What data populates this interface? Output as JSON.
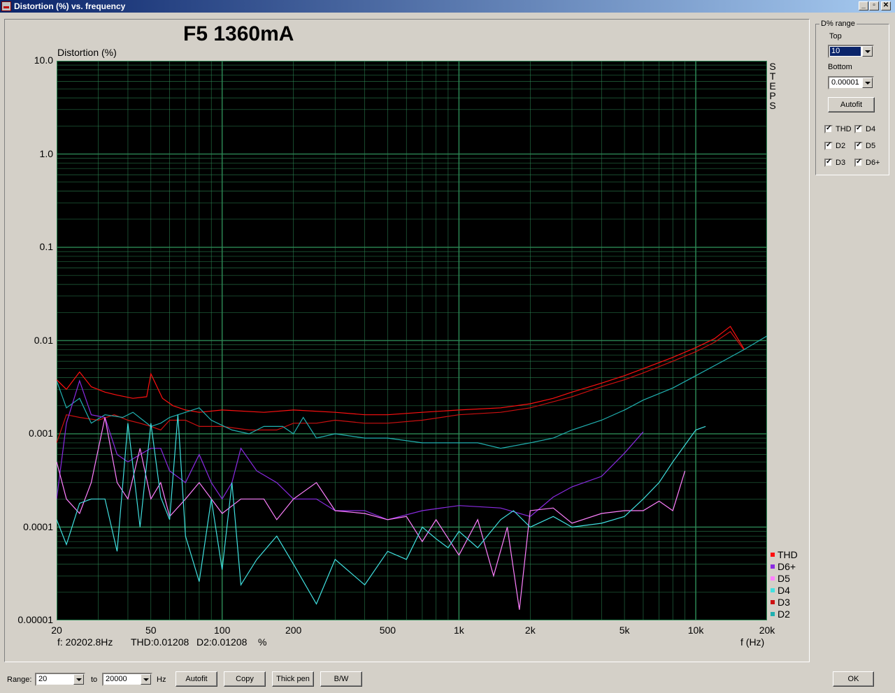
{
  "window": {
    "title": "Distortion (%) vs. frequency",
    "buttons": [
      "_",
      "▫",
      "✕"
    ]
  },
  "graph": {
    "title": "F5 1360mA",
    "readout": {
      "freq": "f: 20202.8Hz",
      "thd": "THD:0.01208",
      "d2": "D2:0.01208",
      "unit": "%"
    },
    "side_label": [
      "S",
      "T",
      "E",
      "P",
      "S"
    ],
    "legend": [
      {
        "name": "THD",
        "color": "#ff1010"
      },
      {
        "name": "D6+",
        "color": "#8a2be2"
      },
      {
        "name": "D5",
        "color": "#ff80ff"
      },
      {
        "name": "D4",
        "color": "#40e0e0"
      },
      {
        "name": "D3",
        "color": "#cc1010"
      },
      {
        "name": "D2",
        "color": "#20b0b0"
      }
    ]
  },
  "chart_data": {
    "type": "line",
    "ylabel": "Distortion (%)",
    "xlabel": "f (Hz)",
    "xscale": "log",
    "yscale": "log",
    "xlim": [
      20,
      20000
    ],
    "ylim": [
      1e-05,
      10
    ],
    "grid": true,
    "background": "#000000",
    "grid_color": "#2e8b57",
    "legend_position": "bottom-right",
    "x_ticks": [
      {
        "label": "20",
        "value": 20
      },
      {
        "label": "50",
        "value": 50
      },
      {
        "label": "100",
        "value": 100
      },
      {
        "label": "200",
        "value": 200
      },
      {
        "label": "500",
        "value": 500
      },
      {
        "label": "1k",
        "value": 1000
      },
      {
        "label": "2k",
        "value": 2000
      },
      {
        "label": "5k",
        "value": 5000
      },
      {
        "label": "10k",
        "value": 10000
      },
      {
        "label": "20k",
        "value": 20000
      }
    ],
    "y_ticks": [
      {
        "label": "10.0",
        "value": 10
      },
      {
        "label": "1.0",
        "value": 1
      },
      {
        "label": "0.1",
        "value": 0.1
      },
      {
        "label": "0.01",
        "value": 0.01
      },
      {
        "label": "0.001",
        "value": 0.001
      },
      {
        "label": "0.0001",
        "value": 0.0001
      },
      {
        "label": "0.00001",
        "value": 1e-05
      }
    ],
    "series": [
      {
        "name": "THD",
        "color": "#ff1010",
        "points": [
          [
            20,
            0.0038
          ],
          [
            22,
            0.003
          ],
          [
            25,
            0.0046
          ],
          [
            28,
            0.0032
          ],
          [
            32,
            0.0028
          ],
          [
            36,
            0.0026
          ],
          [
            42,
            0.0024
          ],
          [
            48,
            0.0025
          ],
          [
            50,
            0.0044
          ],
          [
            56,
            0.0024
          ],
          [
            62,
            0.002
          ],
          [
            70,
            0.0018
          ],
          [
            80,
            0.0017
          ],
          [
            100,
            0.0018
          ],
          [
            150,
            0.0017
          ],
          [
            200,
            0.0018
          ],
          [
            300,
            0.0017
          ],
          [
            400,
            0.0016
          ],
          [
            500,
            0.0016
          ],
          [
            700,
            0.0017
          ],
          [
            1000,
            0.0018
          ],
          [
            1500,
            0.0019
          ],
          [
            2000,
            0.0021
          ],
          [
            2500,
            0.0024
          ],
          [
            3000,
            0.0028
          ],
          [
            4000,
            0.0035
          ],
          [
            5000,
            0.0042
          ],
          [
            6000,
            0.005
          ],
          [
            7000,
            0.0058
          ],
          [
            8000,
            0.0066
          ],
          [
            10000,
            0.0084
          ],
          [
            12000,
            0.0105
          ],
          [
            14000,
            0.0142
          ],
          [
            16000,
            0.0081
          ]
        ]
      },
      {
        "name": "D3",
        "color": "#cc1010",
        "points": [
          [
            20,
            0.0008
          ],
          [
            22,
            0.0016
          ],
          [
            25,
            0.0015
          ],
          [
            30,
            0.0014
          ],
          [
            35,
            0.0016
          ],
          [
            40,
            0.0014
          ],
          [
            45,
            0.0013
          ],
          [
            50,
            0.0012
          ],
          [
            55,
            0.0011
          ],
          [
            60,
            0.0014
          ],
          [
            70,
            0.0014
          ],
          [
            80,
            0.0012
          ],
          [
            100,
            0.0012
          ],
          [
            130,
            0.0011
          ],
          [
            170,
            0.0011
          ],
          [
            200,
            0.0013
          ],
          [
            250,
            0.0013
          ],
          [
            300,
            0.0014
          ],
          [
            400,
            0.0013
          ],
          [
            500,
            0.0013
          ],
          [
            700,
            0.0014
          ],
          [
            1000,
            0.0016
          ],
          [
            1500,
            0.0017
          ],
          [
            2000,
            0.0019
          ],
          [
            3000,
            0.0025
          ],
          [
            4000,
            0.0032
          ],
          [
            5000,
            0.0038
          ],
          [
            6000,
            0.0045
          ],
          [
            8000,
            0.006
          ],
          [
            10000,
            0.0076
          ],
          [
            12000,
            0.0096
          ],
          [
            14000,
            0.0125
          ],
          [
            16000,
            0.0079
          ]
        ]
      },
      {
        "name": "D2",
        "color": "#20b0b0",
        "points": [
          [
            20,
            0.0037
          ],
          [
            22,
            0.0019
          ],
          [
            25,
            0.0024
          ],
          [
            28,
            0.0013
          ],
          [
            32,
            0.0016
          ],
          [
            38,
            0.0015
          ],
          [
            42,
            0.0017
          ],
          [
            50,
            0.0012
          ],
          [
            55,
            0.0013
          ],
          [
            60,
            0.0015
          ],
          [
            70,
            0.0017
          ],
          [
            80,
            0.0019
          ],
          [
            90,
            0.0014
          ],
          [
            110,
            0.0011
          ],
          [
            130,
            0.001
          ],
          [
            150,
            0.0012
          ],
          [
            180,
            0.0012
          ],
          [
            200,
            0.001
          ],
          [
            220,
            0.0015
          ],
          [
            250,
            0.0009
          ],
          [
            300,
            0.001
          ],
          [
            400,
            0.0009
          ],
          [
            500,
            0.0009
          ],
          [
            700,
            0.0008
          ],
          [
            900,
            0.0008
          ],
          [
            1200,
            0.0008
          ],
          [
            1500,
            0.0007
          ],
          [
            2000,
            0.0008
          ],
          [
            2500,
            0.0009
          ],
          [
            3000,
            0.0011
          ],
          [
            4000,
            0.0014
          ],
          [
            5000,
            0.0018
          ],
          [
            6000,
            0.0023
          ],
          [
            8000,
            0.0031
          ],
          [
            10000,
            0.0042
          ],
          [
            13000,
            0.006
          ],
          [
            16000,
            0.008
          ],
          [
            20000,
            0.0112
          ]
        ]
      },
      {
        "name": "D6+",
        "color": "#8a2be2",
        "points": [
          [
            20,
            0.0002
          ],
          [
            22,
            0.0013
          ],
          [
            25,
            0.0037
          ],
          [
            28,
            0.0016
          ],
          [
            32,
            0.0015
          ],
          [
            36,
            0.0006
          ],
          [
            40,
            0.0005
          ],
          [
            45,
            0.0006
          ],
          [
            50,
            0.0007
          ],
          [
            55,
            0.0007
          ],
          [
            60,
            0.0004
          ],
          [
            70,
            0.0003
          ],
          [
            80,
            0.0006
          ],
          [
            90,
            0.0003
          ],
          [
            100,
            0.0002
          ],
          [
            110,
            0.0003
          ],
          [
            120,
            0.0007
          ],
          [
            140,
            0.0004
          ],
          [
            170,
            0.0003
          ],
          [
            200,
            0.0002
          ],
          [
            250,
            0.0002
          ],
          [
            300,
            0.00015
          ],
          [
            400,
            0.00015
          ],
          [
            500,
            0.00012
          ],
          [
            700,
            0.00015
          ],
          [
            1000,
            0.00017
          ],
          [
            1500,
            0.00016
          ],
          [
            2000,
            0.00013
          ],
          [
            2500,
            0.00021
          ],
          [
            3000,
            0.00027
          ],
          [
            4000,
            0.00035
          ],
          [
            5000,
            0.00062
          ],
          [
            6000,
            0.00105
          ]
        ]
      },
      {
        "name": "D5",
        "color": "#ff80ff",
        "points": [
          [
            20,
            0.0005
          ],
          [
            22,
            0.0002
          ],
          [
            25,
            0.00014
          ],
          [
            28,
            0.0003
          ],
          [
            32,
            0.0015
          ],
          [
            36,
            0.0003
          ],
          [
            40,
            0.0002
          ],
          [
            45,
            0.0007
          ],
          [
            50,
            0.0002
          ],
          [
            55,
            0.0003
          ],
          [
            60,
            0.00013
          ],
          [
            70,
            0.0002
          ],
          [
            80,
            0.0003
          ],
          [
            100,
            0.00014
          ],
          [
            120,
            0.0002
          ],
          [
            150,
            0.0002
          ],
          [
            170,
            0.00012
          ],
          [
            200,
            0.0002
          ],
          [
            250,
            0.0003
          ],
          [
            300,
            0.00015
          ],
          [
            400,
            0.00014
          ],
          [
            500,
            0.00012
          ],
          [
            600,
            0.00013
          ],
          [
            700,
            7e-05
          ],
          [
            800,
            0.00012
          ],
          [
            1000,
            5e-05
          ],
          [
            1200,
            0.00012
          ],
          [
            1400,
            3e-05
          ],
          [
            1600,
            0.0001
          ],
          [
            1800,
            1.3e-05
          ],
          [
            2000,
            0.00015
          ],
          [
            2500,
            0.00016
          ],
          [
            3000,
            0.00011
          ],
          [
            4000,
            0.00014
          ],
          [
            5000,
            0.00015
          ],
          [
            6000,
            0.00015
          ],
          [
            7000,
            0.00019
          ],
          [
            8000,
            0.00015
          ],
          [
            9000,
            0.0004
          ]
        ]
      },
      {
        "name": "D4",
        "color": "#40e0e0",
        "points": [
          [
            20,
            0.00012
          ],
          [
            22,
            6.5e-05
          ],
          [
            25,
            0.00018
          ],
          [
            28,
            0.0002
          ],
          [
            32,
            0.0002
          ],
          [
            36,
            5.5e-05
          ],
          [
            40,
            0.0013
          ],
          [
            45,
            0.0001
          ],
          [
            50,
            0.0013
          ],
          [
            55,
            0.00021
          ],
          [
            60,
            0.00012
          ],
          [
            65,
            0.0016
          ],
          [
            70,
            8e-05
          ],
          [
            80,
            2.6e-05
          ],
          [
            90,
            0.0002
          ],
          [
            100,
            3.5e-05
          ],
          [
            110,
            0.0003
          ],
          [
            120,
            2.4e-05
          ],
          [
            140,
            4.5e-05
          ],
          [
            170,
            8e-05
          ],
          [
            200,
            4e-05
          ],
          [
            250,
            1.5e-05
          ],
          [
            300,
            4.5e-05
          ],
          [
            400,
            2.4e-05
          ],
          [
            500,
            5.5e-05
          ],
          [
            600,
            4.5e-05
          ],
          [
            700,
            0.0001
          ],
          [
            800,
            7.5e-05
          ],
          [
            900,
            6e-05
          ],
          [
            1000,
            9e-05
          ],
          [
            1200,
            6e-05
          ],
          [
            1500,
            0.00012
          ],
          [
            1700,
            0.00015
          ],
          [
            2000,
            0.0001
          ],
          [
            2500,
            0.00013
          ],
          [
            3000,
            0.0001
          ],
          [
            4000,
            0.00011
          ],
          [
            5000,
            0.00013
          ],
          [
            6000,
            0.0002
          ],
          [
            7000,
            0.0003
          ],
          [
            8000,
            0.0005
          ],
          [
            10000,
            0.0011
          ],
          [
            11000,
            0.0012
          ]
        ]
      }
    ]
  },
  "range_panel": {
    "group_label": "D% range",
    "top_label": "Top",
    "top_value": "10",
    "bottom_label": "Bottom",
    "bottom_value": "0.00001",
    "autofit_label": "Autofit",
    "checkboxes": [
      "THD",
      "D4",
      "D2",
      "D5",
      "D3",
      "D6+"
    ]
  },
  "toolbar": {
    "range_label": "Range:",
    "range_from": "20",
    "to_label": "to",
    "range_to": "20000",
    "hz_label": "Hz",
    "autofit_label": "Autofit",
    "copy_label": "Copy",
    "thick_pen_label": "Thick pen",
    "bw_label": "B/W",
    "ok_label": "OK"
  }
}
